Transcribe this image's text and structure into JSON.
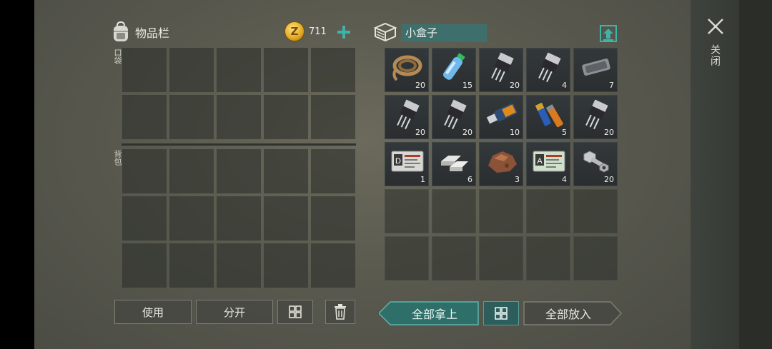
{
  "inventory": {
    "title": "物品栏",
    "coins": "711",
    "pocket_label": "口袋",
    "bag_label": "背包",
    "buttons": {
      "use": "使用",
      "split": "分开"
    }
  },
  "container": {
    "name": "小盒子",
    "items": [
      {
        "name": "rope",
        "qty": "20"
      },
      {
        "name": "water-bottle",
        "qty": "15"
      },
      {
        "name": "transistor",
        "qty": "20"
      },
      {
        "name": "transistor",
        "qty": "4"
      },
      {
        "name": "metal-bar",
        "qty": "7"
      },
      {
        "name": "transistor",
        "qty": "20"
      },
      {
        "name": "transistor",
        "qty": "20"
      },
      {
        "name": "usb-drive",
        "qty": "10"
      },
      {
        "name": "batteries",
        "qty": "5"
      },
      {
        "name": "transistor",
        "qty": "20"
      },
      {
        "name": "id-card-d",
        "qty": "1"
      },
      {
        "name": "silver-ingots",
        "qty": "6"
      },
      {
        "name": "copper-ore",
        "qty": "3"
      },
      {
        "name": "id-card-a",
        "qty": "4"
      },
      {
        "name": "bolt-nut",
        "qty": "20"
      }
    ],
    "buttons": {
      "take_all": "全部拿上",
      "put_all": "全部放入"
    }
  },
  "close_label": "关闭",
  "colors": {
    "accent": "#3d8c86",
    "coin": "#e0a823"
  }
}
